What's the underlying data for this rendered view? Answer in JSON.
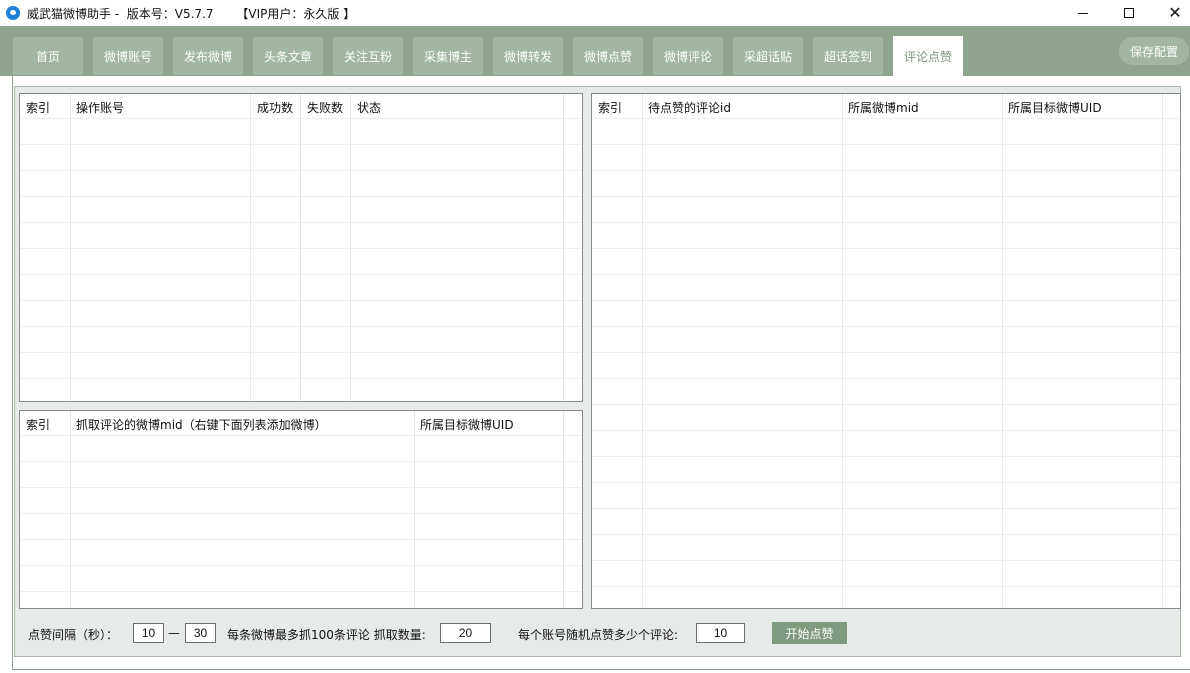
{
  "window": {
    "title": "威武猫微博助手 -  版本号：V5.7.7      【VIP用户：永久版 】"
  },
  "tabs": [
    {
      "label": "首页"
    },
    {
      "label": "微博账号"
    },
    {
      "label": "发布微博"
    },
    {
      "label": "头条文章"
    },
    {
      "label": "关注互粉"
    },
    {
      "label": "采集博主"
    },
    {
      "label": "微博转发"
    },
    {
      "label": "微博点赞"
    },
    {
      "label": "微博评论"
    },
    {
      "label": "采超话贴"
    },
    {
      "label": "超话签到"
    },
    {
      "label": "评论点赞"
    }
  ],
  "active_tab": "评论点赞",
  "save_config_label": "保存配置",
  "accounts_table": {
    "columns": [
      "索引",
      "操作账号",
      "成功数",
      "失败数",
      "状态"
    ]
  },
  "weibo_table": {
    "columns": [
      "索引",
      "抓取评论的微博mid（右键下面列表添加微博）",
      "所属目标微博UID"
    ]
  },
  "comments_table": {
    "columns": [
      "索引",
      "待点赞的评论id",
      "所属微博mid",
      "所属目标微博UID"
    ]
  },
  "controls": {
    "interval_label": "点赞间隔（秒）：",
    "interval_min": "10",
    "interval_dash": "—",
    "interval_max": "30",
    "fetch_label": "每条微博最多抓100条评论 抓取数量:",
    "fetch_count": "20",
    "per_account_label": "每个账号随机点赞多少个评论:",
    "per_account_count": "10",
    "start_button": "开始点赞"
  },
  "colors": {
    "tabbar_bg": "#8fa58f",
    "tab_bg": "#a3b6a3",
    "active_tab_text": "#7e957e",
    "start_button_bg": "#7f9b7f",
    "panel_bg": "#e7ebe7"
  },
  "icons": {
    "app": "weibo-cat-icon",
    "minimize": "minimize-icon",
    "maximize": "maximize-icon",
    "close": "close-icon"
  }
}
